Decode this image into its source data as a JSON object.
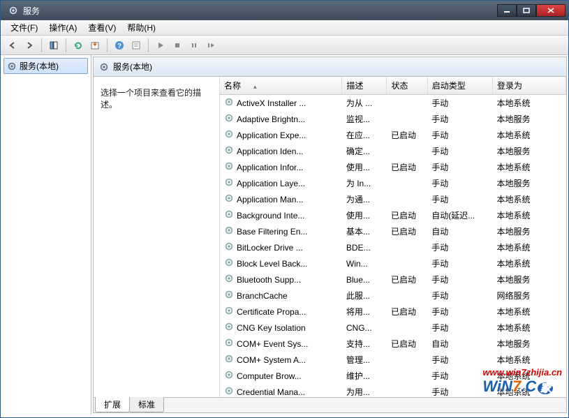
{
  "title": "服务",
  "menus": [
    "文件(F)",
    "操作(A)",
    "查看(V)",
    "帮助(H)"
  ],
  "nav": {
    "item": "服务(本地)"
  },
  "contentTitle": "服务(本地)",
  "descPrompt": "选择一个项目来查看它的描述。",
  "columns": {
    "name": "名称",
    "desc": "描述",
    "status": "状态",
    "startup": "启动类型",
    "logon": "登录为"
  },
  "tabs": {
    "ext": "扩展",
    "std": "标准"
  },
  "watermark": {
    "url": "www.win7zhijia.cn",
    "logo1": "WiN",
    "logo2": "7",
    "logo3": ".C",
    "logo4": "家"
  },
  "services": [
    {
      "name": "ActiveX Installer ...",
      "desc": "为从 ...",
      "status": "",
      "startup": "手动",
      "logon": "本地系统"
    },
    {
      "name": "Adaptive Brightn...",
      "desc": "监视...",
      "status": "",
      "startup": "手动",
      "logon": "本地服务"
    },
    {
      "name": "Application Expe...",
      "desc": "在应...",
      "status": "已启动",
      "startup": "手动",
      "logon": "本地系统"
    },
    {
      "name": "Application Iden...",
      "desc": "确定...",
      "status": "",
      "startup": "手动",
      "logon": "本地服务"
    },
    {
      "name": "Application Infor...",
      "desc": "使用...",
      "status": "已启动",
      "startup": "手动",
      "logon": "本地系统"
    },
    {
      "name": "Application Laye...",
      "desc": "为 In...",
      "status": "",
      "startup": "手动",
      "logon": "本地服务"
    },
    {
      "name": "Application Man...",
      "desc": "为通...",
      "status": "",
      "startup": "手动",
      "logon": "本地系统"
    },
    {
      "name": "Background Inte...",
      "desc": "使用...",
      "status": "已启动",
      "startup": "自动(延迟...",
      "logon": "本地系统"
    },
    {
      "name": "Base Filtering En...",
      "desc": "基本...",
      "status": "已启动",
      "startup": "自动",
      "logon": "本地服务"
    },
    {
      "name": "BitLocker Drive ...",
      "desc": "BDE...",
      "status": "",
      "startup": "手动",
      "logon": "本地系统"
    },
    {
      "name": "Block Level Back...",
      "desc": "Win...",
      "status": "",
      "startup": "手动",
      "logon": "本地系统"
    },
    {
      "name": "Bluetooth Supp...",
      "desc": "Blue...",
      "status": "已启动",
      "startup": "手动",
      "logon": "本地服务"
    },
    {
      "name": "BranchCache",
      "desc": "此服...",
      "status": "",
      "startup": "手动",
      "logon": "网络服务"
    },
    {
      "name": "Certificate Propa...",
      "desc": "将用...",
      "status": "已启动",
      "startup": "手动",
      "logon": "本地系统"
    },
    {
      "name": "CNG Key Isolation",
      "desc": "CNG...",
      "status": "",
      "startup": "手动",
      "logon": "本地系统"
    },
    {
      "name": "COM+ Event Sys...",
      "desc": "支持...",
      "status": "已启动",
      "startup": "自动",
      "logon": "本地服务"
    },
    {
      "name": "COM+ System A...",
      "desc": "管理...",
      "status": "",
      "startup": "手动",
      "logon": "本地系统"
    },
    {
      "name": "Computer Brow...",
      "desc": "维护...",
      "status": "",
      "startup": "手动",
      "logon": "本地系统"
    },
    {
      "name": "Credential Mana...",
      "desc": "为用...",
      "status": "",
      "startup": "手动",
      "logon": "本地系统"
    }
  ]
}
